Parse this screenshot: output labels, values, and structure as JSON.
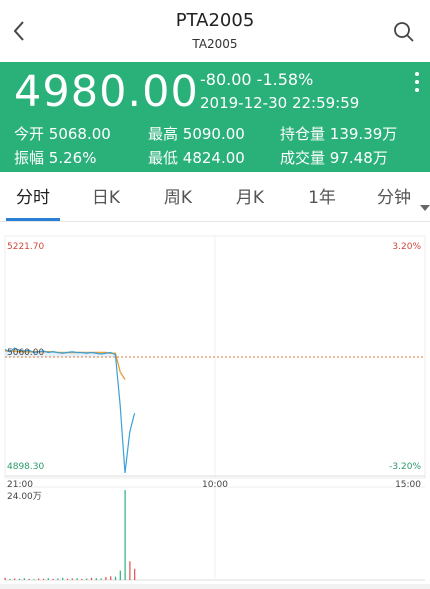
{
  "header": {
    "title": "PTA2005",
    "subtitle": "TA2005"
  },
  "quote": {
    "price": "4980.00",
    "change": "-80.00 -1.58%",
    "datetime": "2019-12-30 22:59:59",
    "stats": {
      "open_label": "今开",
      "open_value": "5068.00",
      "high_label": "最高",
      "high_value": "5090.00",
      "oi_label": "持仓量",
      "oi_value": "139.39万",
      "amp_label": "振幅",
      "amp_value": "5.26%",
      "low_label": "最低",
      "low_value": "4824.00",
      "vol_label": "成交量",
      "vol_value": "97.48万"
    },
    "colors": {
      "background": "#2ab17a",
      "text": "#ffffff"
    }
  },
  "tabs": [
    {
      "label": "分时",
      "active": true
    },
    {
      "label": "日K",
      "active": false
    },
    {
      "label": "周K",
      "active": false
    },
    {
      "label": "月K",
      "active": false
    },
    {
      "label": "1年",
      "active": false
    },
    {
      "label": "分钟",
      "active": false
    }
  ],
  "icons": {
    "back": "chevron-left-icon",
    "search": "search-icon",
    "more": "more-vertical-icon"
  },
  "chart_data": {
    "type": "line",
    "ylim": [
      4898.3,
      5221.7
    ],
    "reference_price": 5060.0,
    "y_labels": {
      "top": "5221.70",
      "mid": "5060.00",
      "bottom": "4898.30"
    },
    "pct_labels": {
      "top": "3.20%",
      "bottom": "-3.20%"
    },
    "x_ticks": [
      "21:00",
      "10:00",
      "15:00"
    ],
    "volume_label": "24.00万",
    "volume_max": 24.0,
    "price_series": [
      5070,
      5067,
      5072,
      5069,
      5068,
      5069,
      5066,
      5067,
      5068,
      5066,
      5067,
      5066,
      5065,
      5066,
      5067,
      5066,
      5066,
      5065,
      5066,
      5065,
      5064,
      5065,
      5066,
      5063,
      4995,
      4905,
      4960,
      4985
    ],
    "avg_series": [
      5068,
      5068,
      5068,
      5067,
      5067,
      5067,
      5067,
      5067,
      5067,
      5067,
      5067,
      5066,
      5066,
      5066,
      5066,
      5066,
      5066,
      5066,
      5066,
      5066,
      5066,
      5066,
      5065,
      5065,
      5040,
      5030,
      null,
      null
    ],
    "volume_series": [
      0.6,
      0.3,
      0.4,
      0.3,
      0.5,
      0.3,
      0.2,
      0.4,
      0.3,
      0.5,
      0.3,
      0.4,
      0.6,
      0.3,
      0.4,
      0.5,
      0.3,
      0.4,
      0.6,
      0.5,
      0.4,
      0.8,
      1.0,
      0.9,
      2.5,
      24.0,
      5.0,
      3.0
    ],
    "colors": {
      "price": "#3aa0d8",
      "avg": "#e8a23a",
      "reference": "#e07a3a",
      "up": "#e05050",
      "down": "#2ab17a",
      "volume": "#aacdea"
    },
    "grid": true
  }
}
